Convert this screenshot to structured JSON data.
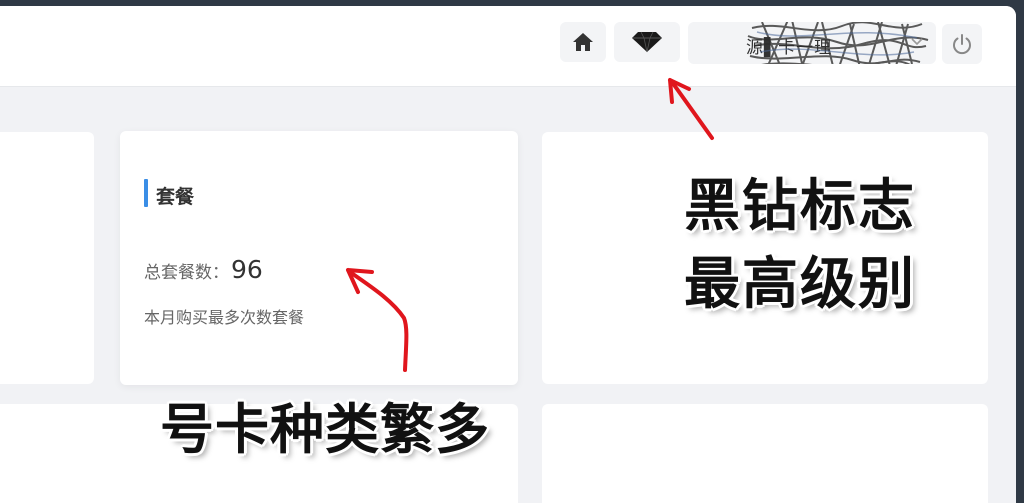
{
  "header": {
    "user_name": "源▌卡一理"
  },
  "package_card": {
    "title": "套餐",
    "total_label": "总套餐数：",
    "total_value": "96",
    "subtitle": "本月购买最多次数套餐"
  },
  "annotations": {
    "diamond_caption_line1": "黑钻标志",
    "diamond_caption_line2": "最高级别",
    "variety_caption": "号卡种类繁多"
  },
  "icons": {
    "home": "home-icon",
    "diamond": "diamond-icon",
    "chevron": "chevron-down-icon",
    "power": "power-icon"
  },
  "colors": {
    "accent": "#3a8ee6",
    "arrow": "#e0161d"
  }
}
